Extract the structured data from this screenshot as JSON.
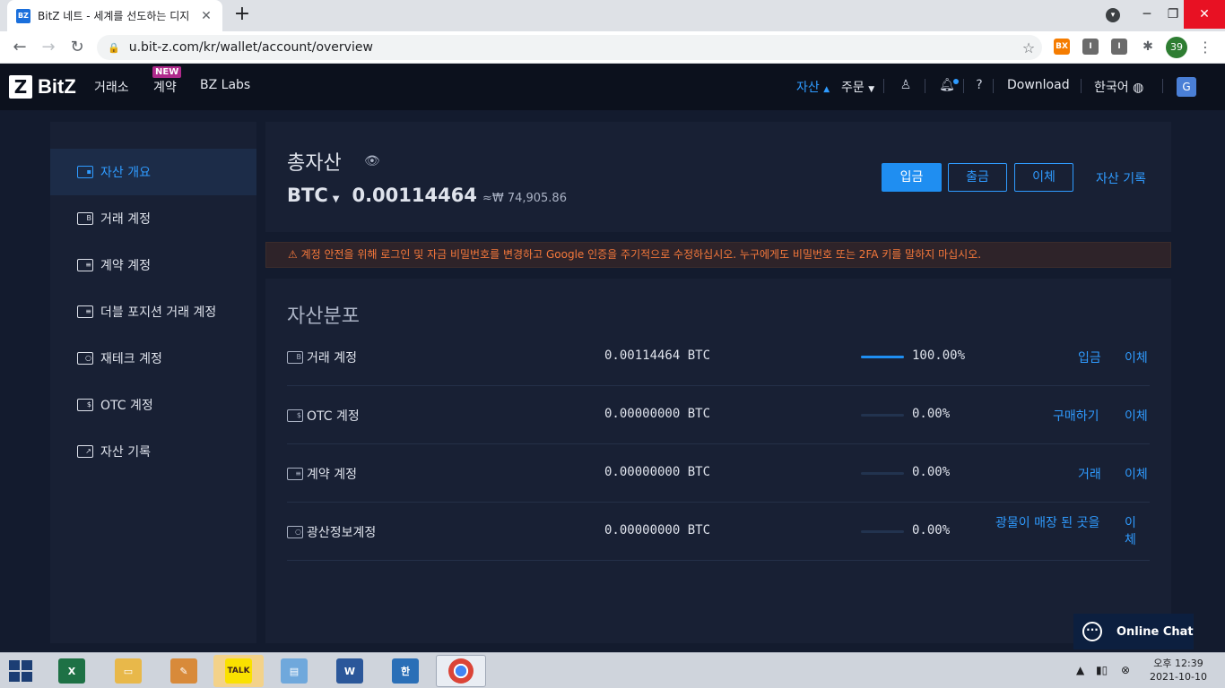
{
  "browser": {
    "tab_title": "BitZ 네트 - 세계를 선도하는 디지",
    "url": "u.bit-z.com/kr/wallet/account/overview",
    "profile_count": "39"
  },
  "nav": {
    "logo": "BitZ",
    "exchange": "거래소",
    "contract": "계약",
    "new_badge": "NEW",
    "labs": "BZ Labs",
    "assets": "자산",
    "orders": "주문",
    "download": "Download",
    "language": "한국어"
  },
  "sidebar": {
    "items": [
      {
        "label": "자산 개요",
        "active": true
      },
      {
        "label": "거래 계정"
      },
      {
        "label": "계약 계정"
      },
      {
        "label": "더블 포지션 거래 계정"
      },
      {
        "label": "재테크 계정"
      },
      {
        "label": "OTC 계정"
      },
      {
        "label": "자산 기록"
      }
    ]
  },
  "overview": {
    "title": "총자산",
    "unit": "BTC",
    "amount": "0.00114464",
    "krw": "≈₩ 74,905.86",
    "deposit": "입금",
    "withdraw": "출금",
    "transfer": "이체",
    "history": "자산 기록"
  },
  "alert": "⚠ 계정 안전을 위해 로그인 및 자금 비밀번호를 변경하고 Google 인증을 주기적으로 수정하십시오. 누구에게도 비밀번호 또는 2FA 키를 말하지 마십시오.",
  "distribution": {
    "title": "자산분포",
    "rows": [
      {
        "name": "거래 계정",
        "amount": "0.00114464  BTC",
        "pct": "100.00%",
        "pct_value": 100,
        "action1": "입금",
        "action2": "이체"
      },
      {
        "name": "OTC 계정",
        "amount": "0.00000000  BTC",
        "pct": "0.00%",
        "pct_value": 0,
        "action1": "구매하기",
        "action2": "이체"
      },
      {
        "name": "계약 계정",
        "amount": "0.00000000  BTC",
        "pct": "0.00%",
        "pct_value": 0,
        "action1": "거래",
        "action2": "이체"
      },
      {
        "name": "광산정보계정",
        "amount": "0.00000000  BTC",
        "pct": "0.00%",
        "pct_value": 0,
        "action1": "광물이 매장 된 곳을",
        "action2": "이체"
      }
    ]
  },
  "chat": "Online Chat",
  "clock": {
    "time": "오후 12:39",
    "date": "2021-10-10"
  },
  "taskbar_apps": [
    "excel",
    "explorer",
    "paint",
    "kakaotalk",
    "notepad",
    "word",
    "hangul",
    "chrome"
  ]
}
